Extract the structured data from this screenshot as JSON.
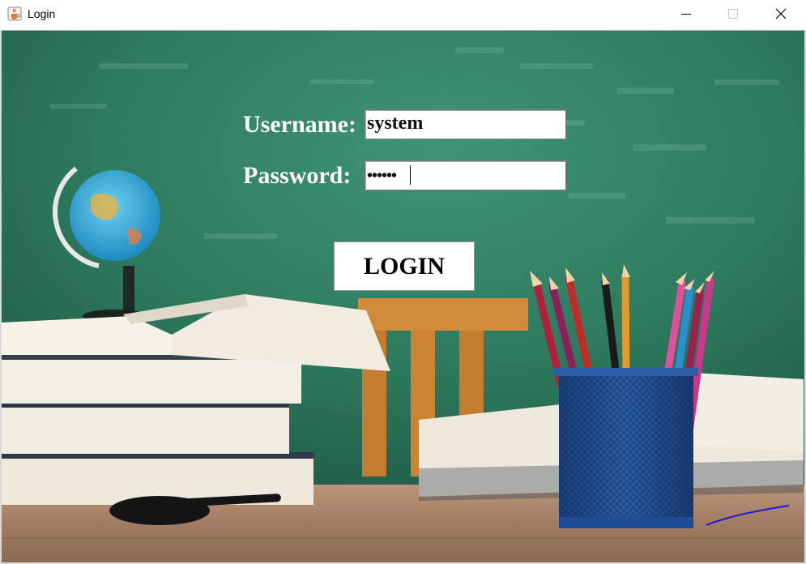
{
  "window": {
    "title": "Login",
    "controls": [
      "minimize",
      "maximize",
      "close"
    ]
  },
  "form": {
    "username_label": "Username:",
    "username_value": "system",
    "password_label": "Password:",
    "password_masked": "••••••",
    "login_button": "LOGIN"
  },
  "colors": {
    "chalkboard": "#2f7a5e",
    "label_text": "#ffffff",
    "annotation_stroke": "#1a1ad8"
  },
  "icons": {
    "app_icon": "java-cup-icon",
    "minimize": "minimize-icon",
    "maximize": "maximize-icon",
    "close": "close-icon"
  }
}
